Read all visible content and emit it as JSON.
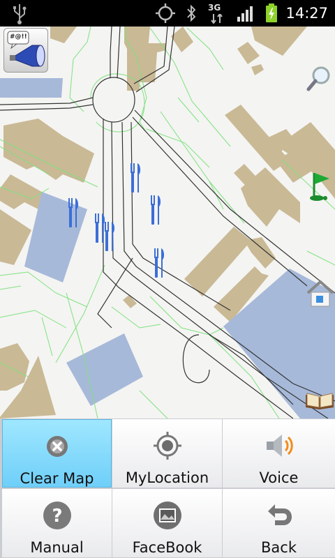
{
  "status_bar": {
    "time": "14:27",
    "network_type": "3G",
    "icons": [
      "usb-icon",
      "gps-icon",
      "bluetooth-icon",
      "network-3g-icon",
      "signal-icon",
      "battery-charging-icon"
    ]
  },
  "map": {
    "overlay_buttons": [
      "megaphone-icon",
      "search-icon",
      "golf-flag-icon",
      "home-icon",
      "book-icon"
    ],
    "poi_icons": [
      "restaurant-icon",
      "restaurant-icon",
      "restaurant-icon",
      "restaurant-icon",
      "restaurant-icon",
      "restaurant-icon"
    ],
    "megaphone_text": "#@!!"
  },
  "menu": {
    "items": [
      {
        "label": "Clear Map",
        "icon": "close-circle-icon",
        "selected": true
      },
      {
        "label": "MyLocation",
        "icon": "crosshair-icon",
        "selected": false
      },
      {
        "label": "Voice",
        "icon": "speaker-icon",
        "selected": false
      },
      {
        "label": "Manual",
        "icon": "help-icon",
        "selected": false
      },
      {
        "label": "FaceBook",
        "icon": "picture-icon",
        "selected": false
      },
      {
        "label": "Back",
        "icon": "back-arrow-icon",
        "selected": false
      }
    ]
  },
  "colors": {
    "building": "#c9b995",
    "water": "#a7b9d9",
    "road": "#333333",
    "boundary": "#7ee27e",
    "menu_selected": "#7fd8fb"
  }
}
